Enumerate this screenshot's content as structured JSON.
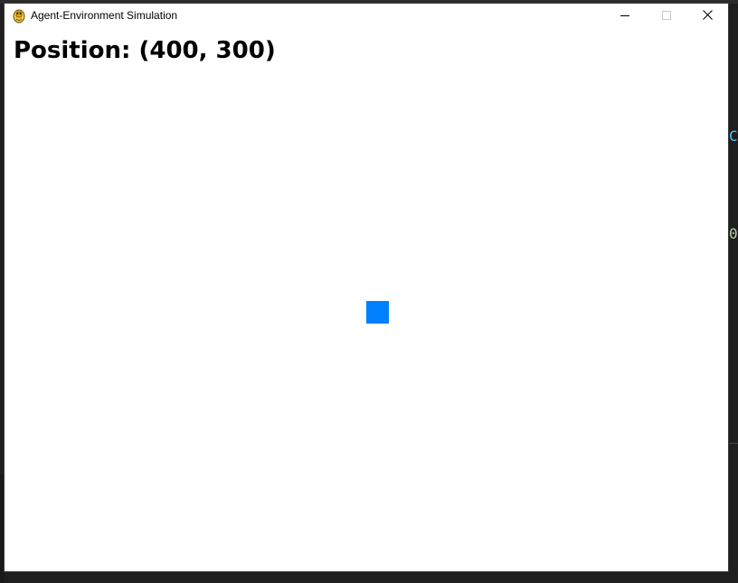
{
  "window": {
    "title": "Agent-Environment Simulation",
    "icon": "python-snake-icon",
    "controls": {
      "minimize": "minimize-icon",
      "maximize": "maximize-icon",
      "close": "close-icon"
    }
  },
  "simulation": {
    "position_text": "Position: (400, 300)",
    "agent_color": "#0080ff",
    "background_color": "#ffffff"
  },
  "background": {
    "editor_glyph_1": "C",
    "editor_glyph_2": "0"
  }
}
